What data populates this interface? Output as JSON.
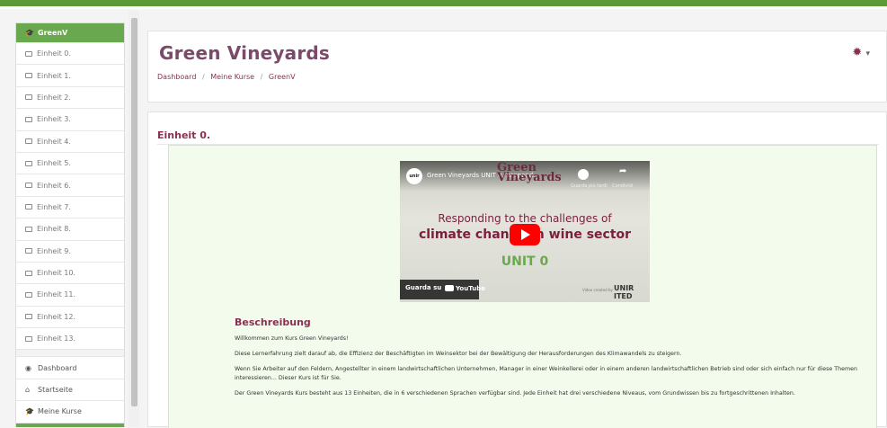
{
  "sidebar": {
    "course": "GreenV",
    "units": [
      "Einheit 0.",
      "Einheit 1.",
      "Einheit 2.",
      "Einheit 3.",
      "Einheit 4.",
      "Einheit 5.",
      "Einheit 6.",
      "Einheit 7.",
      "Einheit 8.",
      "Einheit 9.",
      "Einheit 10.",
      "Einheit 11.",
      "Einheit 12.",
      "Einheit 13."
    ],
    "nav": {
      "dashboard": "Dashboard",
      "home": "Startseite",
      "my_courses": "Meine Kurse"
    }
  },
  "header": {
    "title": "Green Vineyards",
    "breadcrumb": [
      "Dashboard",
      "Meine Kurse",
      "GreenV"
    ],
    "breadcrumb_sep": "/"
  },
  "section": {
    "title": "Einheit 0."
  },
  "video": {
    "channel_logo": "unir",
    "title": "Green Vineyards UNIT 0. Respond...",
    "logo_line1": "Green",
    "logo_line2": "Vineyards",
    "watch_later": "Guarda più tardi",
    "share": "Condividi",
    "headline1": "Responding to the challenges of",
    "headline2": "climate change in wine sector",
    "unit": "UNIT 0",
    "watch_on": "Guarda su",
    "youtube": "YouTube",
    "credit": "Video created by",
    "credit_brand": "UNIR ITED"
  },
  "description": {
    "title": "Beschreibung",
    "paragraphs": [
      "Willkommen zum Kurs Green Vineyards!",
      "Diese Lernerfahrung zielt darauf ab, die Effizienz der Beschäftigten im Weinsektor bei der Bewältigung der Herausforderungen des Klimawandels zu steigern.",
      "Wenn Sie Arbeiter auf den Feldern, Angestellter in einem landwirtschaftlichen Unternehmen, Manager in einer Weinkellerei oder in einem anderen landwirtschaftlichen Betrieb sind oder sich einfach nur für diese Themen interessieren... Dieser Kurs ist für Sie.",
      "Der Green Vineyards Kurs besteht aus 13 Einheiten, die in 6 verschiedenen Sprachen verfügbar sind. Jede Einheit hat drei verschiedene Niveaus, vom Grundwissen bis zu fortgeschrittenen Inhalten."
    ]
  },
  "colors": {
    "accent": "#6aa84f",
    "brand": "#8a3052",
    "content_bg": "#f2fbec"
  }
}
